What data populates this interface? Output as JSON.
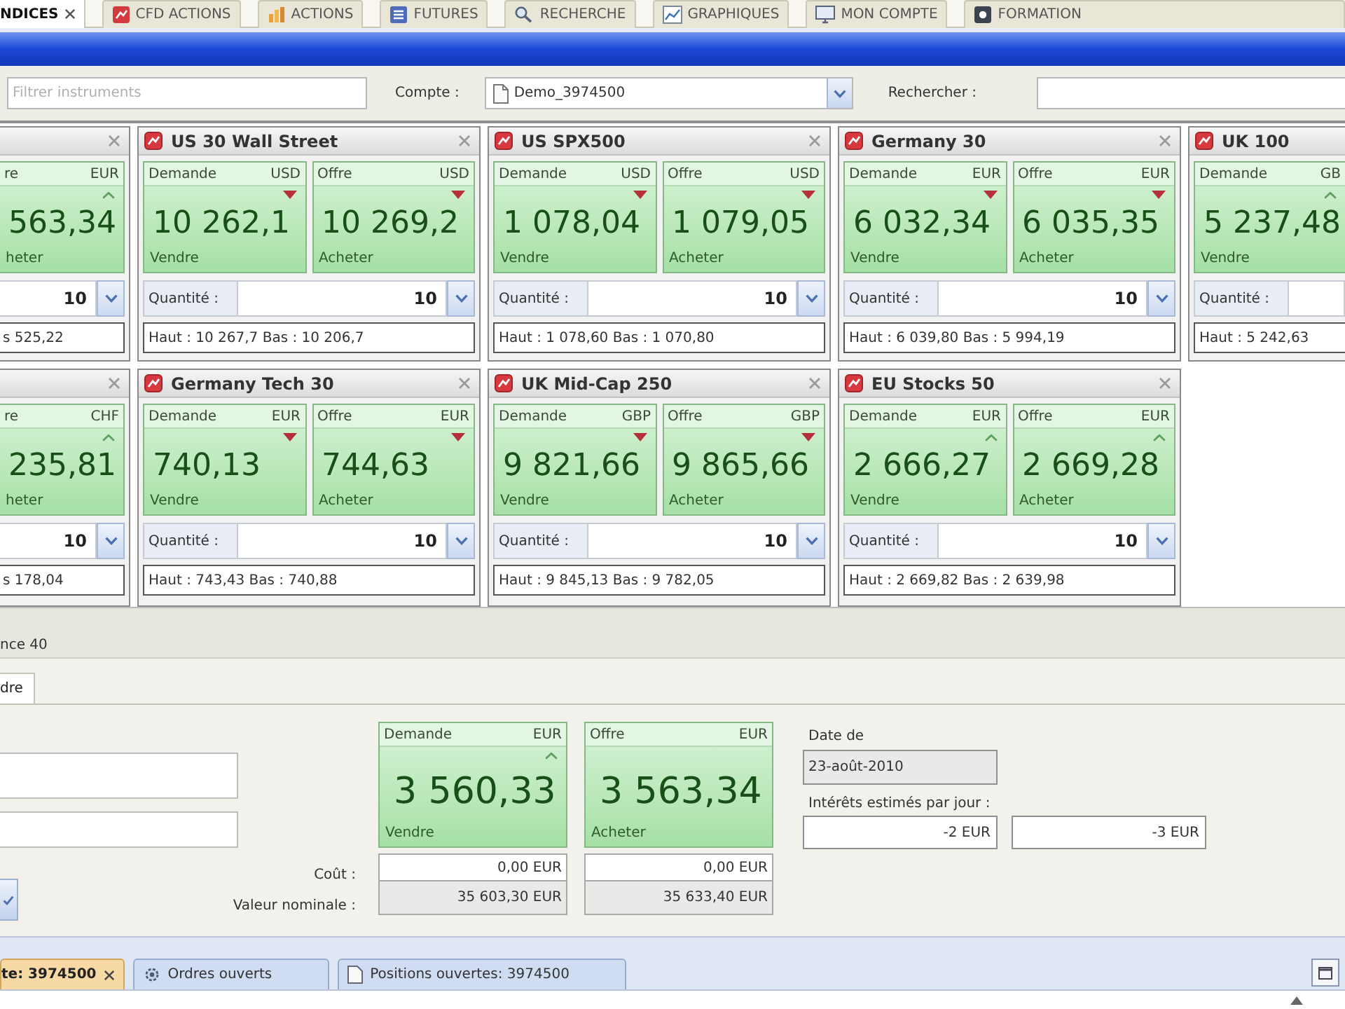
{
  "top_tabs": [
    {
      "label": "NDICES",
      "selected": true
    },
    {
      "label": "CFD ACTIONS",
      "selected": false
    },
    {
      "label": "ACTIONS",
      "selected": false
    },
    {
      "label": "FUTURES",
      "selected": false
    },
    {
      "label": "RECHERCHE",
      "selected": false
    },
    {
      "label": "GRAPHIQUES",
      "selected": false
    },
    {
      "label": "MON COMPTE",
      "selected": false
    },
    {
      "label": "FORMATION",
      "selected": false
    }
  ],
  "toolbar": {
    "search": {
      "placeholder": "Filtrer instruments"
    },
    "account_label": "Compte :",
    "account_value": "Demo_3974500",
    "find_label": "Rechercher :"
  },
  "card_rows": [
    [
      {
        "kind": "clipped_left",
        "quotes": [
          {
            "label": "re",
            "currency": "EUR",
            "falling": false,
            "price": "563,34",
            "action": "heter"
          }
        ],
        "quantity": "10",
        "range": "s 525,22"
      },
      {
        "kind": "full",
        "title": "US 30 Wall Street",
        "quotes": [
          {
            "label": "Demande",
            "currency": "USD",
            "falling": true,
            "price": "10 262,1",
            "action": "Vendre"
          },
          {
            "label": "Offre",
            "currency": "USD",
            "falling": true,
            "price": "10 269,2",
            "action": "Acheter"
          }
        ],
        "quantity_label": "Quantité :",
        "quantity": "10",
        "range": "Haut : 10 267,7 Bas : 10 206,7"
      },
      {
        "kind": "full",
        "title": "US SPX500",
        "quotes": [
          {
            "label": "Demande",
            "currency": "USD",
            "falling": true,
            "price": "1 078,04",
            "action": "Vendre"
          },
          {
            "label": "Offre",
            "currency": "USD",
            "falling": true,
            "price": "1 079,05",
            "action": "Acheter"
          }
        ],
        "quantity_label": "Quantité :",
        "quantity": "10",
        "range": "Haut : 1 078,60 Bas : 1 070,80"
      },
      {
        "kind": "full",
        "title": "Germany 30",
        "quotes": [
          {
            "label": "Demande",
            "currency": "EUR",
            "falling": true,
            "price": "6 032,34",
            "action": "Vendre"
          },
          {
            "label": "Offre",
            "currency": "EUR",
            "falling": true,
            "price": "6 035,35",
            "action": "Acheter"
          }
        ],
        "quantity_label": "Quantité :",
        "quantity": "10",
        "range": "Haut : 6 039,80 Bas : 5 994,19"
      },
      {
        "kind": "clipped_right",
        "title": "UK 100",
        "quotes": [
          {
            "label": "Demande",
            "currency": "GB",
            "falling": false,
            "price": "5 237,48",
            "action": "Vendre"
          }
        ],
        "quantity_label": "Quantité :",
        "range": "Haut : 5 242,63"
      }
    ],
    [
      {
        "kind": "clipped_left",
        "quotes": [
          {
            "label": "re",
            "currency": "CHF",
            "falling": false,
            "price": "235,81",
            "action": "heter"
          }
        ],
        "quantity": "10",
        "range": "s 178,04"
      },
      {
        "kind": "full",
        "title": "Germany Tech 30",
        "quotes": [
          {
            "label": "Demande",
            "currency": "EUR",
            "falling": true,
            "price": "740,13",
            "action": "Vendre"
          },
          {
            "label": "Offre",
            "currency": "EUR",
            "falling": true,
            "price": "744,63",
            "action": "Acheter"
          }
        ],
        "quantity_label": "Quantité :",
        "quantity": "10",
        "range": "Haut : 743,43 Bas : 740,88"
      },
      {
        "kind": "full",
        "title": "UK Mid-Cap 250",
        "quotes": [
          {
            "label": "Demande",
            "currency": "GBP",
            "falling": true,
            "price": "9 821,66",
            "action": "Vendre"
          },
          {
            "label": "Offre",
            "currency": "GBP",
            "falling": true,
            "price": "9 865,66",
            "action": "Acheter"
          }
        ],
        "quantity_label": "Quantité :",
        "quantity": "10",
        "range": "Haut : 9 845,13 Bas : 9 782,05"
      },
      {
        "kind": "full",
        "title": "EU Stocks 50",
        "quotes": [
          {
            "label": "Demande",
            "currency": "EUR",
            "falling": false,
            "price": "2 666,27",
            "action": "Vendre"
          },
          {
            "label": "Offre",
            "currency": "EUR",
            "falling": false,
            "price": "2 669,28",
            "action": "Acheter"
          }
        ],
        "quantity_label": "Quantité :",
        "quantity": "10",
        "range": "Haut : 2 669,82 Bas : 2 639,98"
      }
    ]
  ],
  "deal_panel": {
    "title": "nce 40",
    "tab": {
      "label": "dre",
      "selected": true
    },
    "cost_label": "Coût :",
    "notional_label": "Valeur nominale :",
    "quotes": [
      {
        "label": "Demande",
        "currency": "EUR",
        "falling": false,
        "price": "3 560,33",
        "action": "Vendre",
        "cost": "0,00 EUR",
        "notional": "35 603,30 EUR"
      },
      {
        "label": "Offre",
        "currency": "EUR",
        "price": "3 563,34",
        "action": "Acheter",
        "cost": "0,00 EUR",
        "notional": "35 633,40 EUR"
      }
    ],
    "date_label": "Date de",
    "date": "23-août-2010",
    "interest_label": "Intérêts estimés par jour :",
    "interest": [
      "-2 EUR",
      "-3 EUR"
    ]
  },
  "bottom_tabs": [
    {
      "label": "te: 3974500",
      "selected": true
    },
    {
      "label": "Ordres ouverts",
      "selected": false
    },
    {
      "label": "Positions ouvertes: 3974500",
      "selected": false
    }
  ]
}
